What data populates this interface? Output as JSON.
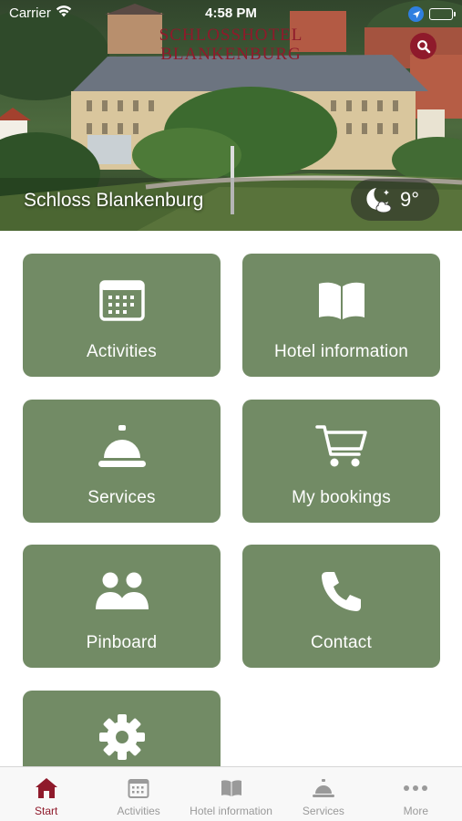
{
  "status_bar": {
    "carrier": "Carrier",
    "time": "4:58 PM"
  },
  "header": {
    "brand_line1": "SCHLOSSHOTEL",
    "brand_line2": "BLANKENBURG",
    "hotel_name": "Schloss Blankenburg",
    "weather": {
      "icon": "moon-cloud-icon",
      "temperature": "9°"
    }
  },
  "colors": {
    "accent": "#8f1a2b",
    "tile": "#728b65",
    "tab_inactive": "#9a9a9a"
  },
  "tiles": [
    {
      "label": "Activities",
      "icon": "calendar-icon"
    },
    {
      "label": "Hotel information",
      "icon": "book-icon"
    },
    {
      "label": "Services",
      "icon": "service-bell-icon"
    },
    {
      "label": "My bookings",
      "icon": "shopping-cart-icon"
    },
    {
      "label": "Pinboard",
      "icon": "people-icon"
    },
    {
      "label": "Contact",
      "icon": "phone-icon"
    },
    {
      "label": "",
      "icon": "gear-icon"
    }
  ],
  "tabbar": {
    "items": [
      {
        "label": "Start",
        "icon": "home-icon",
        "active": true
      },
      {
        "label": "Activities",
        "icon": "calendar-icon",
        "active": false
      },
      {
        "label": "Hotel information",
        "icon": "book-icon",
        "active": false
      },
      {
        "label": "Services",
        "icon": "service-bell-icon",
        "active": false
      },
      {
        "label": "More",
        "icon": "more-icon",
        "active": false
      }
    ]
  }
}
